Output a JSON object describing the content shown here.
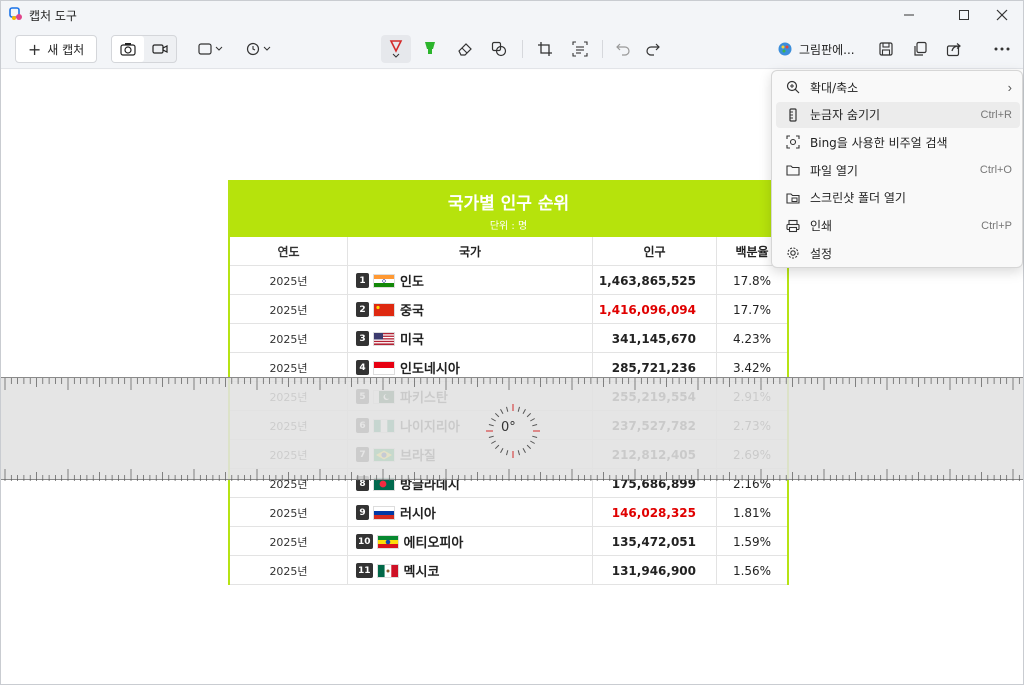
{
  "window": {
    "title": "캡처 도구"
  },
  "toolbar": {
    "new_capture_label": "새 캡처",
    "paint_label": "그림판에..."
  },
  "table": {
    "title": "국가별 인구 순위",
    "unit": "단위 : 명",
    "headers": [
      "연도",
      "국가",
      "인구",
      "백분율"
    ],
    "rows": [
      {
        "year": "2025년",
        "rank": "1",
        "flag": "india",
        "country": "인도",
        "population": "1,463,865,525",
        "percent": "17.8%",
        "highlight": false
      },
      {
        "year": "2025년",
        "rank": "2",
        "flag": "china",
        "country": "중국",
        "population": "1,416,096,094",
        "percent": "17.7%",
        "highlight": true
      },
      {
        "year": "2025년",
        "rank": "3",
        "flag": "usa",
        "country": "미국",
        "population": "341,145,670",
        "percent": "4.23%",
        "highlight": false
      },
      {
        "year": "2025년",
        "rank": "4",
        "flag": "indonesia",
        "country": "인도네시아",
        "population": "285,721,236",
        "percent": "3.42%",
        "highlight": false
      },
      {
        "year": "2025년",
        "rank": "5",
        "flag": "pakistan",
        "country": "파키스탄",
        "population": "255,219,554",
        "percent": "2.91%",
        "highlight": false
      },
      {
        "year": "2025년",
        "rank": "6",
        "flag": "nigeria",
        "country": "나이지리아",
        "population": "237,527,782",
        "percent": "2.73%",
        "highlight": false
      },
      {
        "year": "2025년",
        "rank": "7",
        "flag": "brazil",
        "country": "브라질",
        "population": "212,812,405",
        "percent": "2.69%",
        "highlight": false
      },
      {
        "year": "2025년",
        "rank": "8",
        "flag": "bangladesh",
        "country": "방글라데시",
        "population": "175,686,899",
        "percent": "2.16%",
        "highlight": false
      },
      {
        "year": "2025년",
        "rank": "9",
        "flag": "russia",
        "country": "러시아",
        "population": "146,028,325",
        "percent": "1.81%",
        "highlight": true
      },
      {
        "year": "2025년",
        "rank": "10",
        "flag": "ethiopia",
        "country": "에티오피아",
        "population": "135,472,051",
        "percent": "1.59%",
        "highlight": false
      },
      {
        "year": "2025년",
        "rank": "11",
        "flag": "mexico",
        "country": "멕시코",
        "population": "131,946,900",
        "percent": "1.56%",
        "highlight": false
      }
    ]
  },
  "ruler": {
    "angle": "0°"
  },
  "menu": {
    "items": [
      {
        "icon": "zoom-icon",
        "label": "확대/축소",
        "shortcut": "",
        "submenu": true
      },
      {
        "icon": "ruler-icon",
        "label": "눈금자 숨기기",
        "shortcut": "Ctrl+R",
        "submenu": false
      },
      {
        "icon": "visual-search-icon",
        "label": "Bing을 사용한 비주얼 검색",
        "shortcut": "",
        "submenu": false
      },
      {
        "icon": "folder-open-icon",
        "label": "파일 열기",
        "shortcut": "Ctrl+O",
        "submenu": false
      },
      {
        "icon": "screenshot-folder-icon",
        "label": "스크린샷 폴더 열기",
        "shortcut": "",
        "submenu": false
      },
      {
        "icon": "print-icon",
        "label": "인쇄",
        "shortcut": "Ctrl+P",
        "submenu": false
      },
      {
        "icon": "settings-icon",
        "label": "설정",
        "shortcut": "",
        "submenu": false
      }
    ]
  },
  "colors": {
    "accent": "#b6e30c",
    "highlight_red": "#e00000",
    "pen_red": "#d42a2a",
    "highlighter_green": "#2cb52c"
  }
}
